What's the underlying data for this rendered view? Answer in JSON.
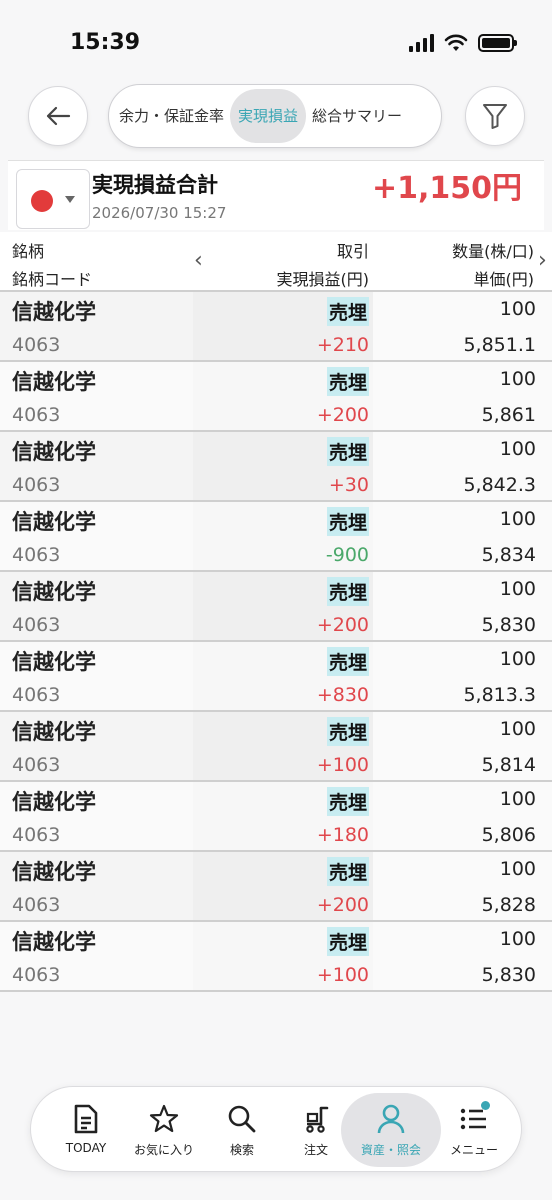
{
  "status_bar": {
    "time": "15:39"
  },
  "nav": {
    "tabs": [
      {
        "label": "余力・保証金率",
        "active": false
      },
      {
        "label": "実現損益",
        "active": true
      },
      {
        "label": "総合サマリー",
        "active": false
      }
    ]
  },
  "summary": {
    "title": "実現損益合計",
    "date": "2026/07/30 15:27",
    "value": "+1,150円",
    "flag_color": "#e23b3b"
  },
  "table": {
    "headers": {
      "col1_line1": "銘柄",
      "col1_line2": "銘柄コード",
      "col2_line1": "取引",
      "col2_line2": "実現損益(円)",
      "col3_line1": "数量(株/口)",
      "col3_line2": "単価(円)"
    },
    "rows": [
      {
        "name": "信越化学",
        "code": "4063",
        "trade": "売埋",
        "pnl": "+210",
        "qty": "100",
        "price": "5,851.1"
      },
      {
        "name": "信越化学",
        "code": "4063",
        "trade": "売埋",
        "pnl": "+200",
        "qty": "100",
        "price": "5,861"
      },
      {
        "name": "信越化学",
        "code": "4063",
        "trade": "売埋",
        "pnl": "+30",
        "qty": "100",
        "price": "5,842.3"
      },
      {
        "name": "信越化学",
        "code": "4063",
        "trade": "売埋",
        "pnl": "-900",
        "qty": "100",
        "price": "5,834"
      },
      {
        "name": "信越化学",
        "code": "4063",
        "trade": "売埋",
        "pnl": "+200",
        "qty": "100",
        "price": "5,830"
      },
      {
        "name": "信越化学",
        "code": "4063",
        "trade": "売埋",
        "pnl": "+830",
        "qty": "100",
        "price": "5,813.3"
      },
      {
        "name": "信越化学",
        "code": "4063",
        "trade": "売埋",
        "pnl": "+100",
        "qty": "100",
        "price": "5,814"
      },
      {
        "name": "信越化学",
        "code": "4063",
        "trade": "売埋",
        "pnl": "+180",
        "qty": "100",
        "price": "5,806"
      },
      {
        "name": "信越化学",
        "code": "4063",
        "trade": "売埋",
        "pnl": "+200",
        "qty": "100",
        "price": "5,828"
      },
      {
        "name": "信越化学",
        "code": "4063",
        "trade": "売埋",
        "pnl": "+100",
        "qty": "100",
        "price": "5,830"
      }
    ]
  },
  "bottom_nav": {
    "items": [
      {
        "label": "TODAY",
        "icon": "document-icon"
      },
      {
        "label": "お気に入り",
        "icon": "star-icon"
      },
      {
        "label": "検索",
        "icon": "search-icon"
      },
      {
        "label": "注文",
        "icon": "cart-icon"
      },
      {
        "label": "資産・照会",
        "icon": "person-icon"
      },
      {
        "label": "メニュー",
        "icon": "menu-list-icon"
      }
    ]
  },
  "colors": {
    "accent": "#3aa6b4",
    "positive": "#e0474c",
    "negative": "#4aa86a",
    "trade_highlight": "#c7ecf1"
  }
}
